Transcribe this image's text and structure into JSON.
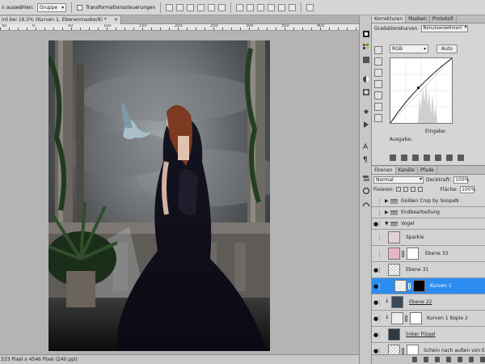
{
  "options_bar": {
    "auto_select_label": "n auswählen:",
    "auto_select_value": "Gruppe",
    "transform_label": "Transformationssteuerungen"
  },
  "document": {
    "tab_title": "ird bei 16,5% (Kurven 1, Ebenenmaske/8) *",
    "close_glyph": "×",
    "ruler_marks": [
      "50",
      "0",
      "50",
      "100",
      "150",
      "200",
      "250",
      "300",
      "350",
      "400"
    ],
    "status": "333 Pixel x 4546 Pixel (240 ppi)"
  },
  "adjustments": {
    "tabs": [
      "Korrekturen",
      "Masken",
      "Protokoll"
    ],
    "title": "Gradationskurven",
    "preset": "Benutzerdefiniert",
    "channel": "RGB",
    "auto_button": "Auto",
    "output_label": "Ausgabe:",
    "input_label": "Eingabe:"
  },
  "layers_panel": {
    "tabs": [
      "Ebenen",
      "Kanäle",
      "Pfade"
    ],
    "blend_mode": "Normal",
    "opacity_label": "Deckkraft:",
    "opacity_value": "100%",
    "lock_label": "Fixieren:",
    "fill_label": "Fläche:",
    "fill_value": "100%",
    "layers": [
      {
        "name": "Golden Crop by SoopeN",
        "kind": "group",
        "visible": false,
        "open": false
      },
      {
        "name": "Endbearbeitung",
        "kind": "group",
        "visible": false,
        "open": false
      },
      {
        "name": "Vogel",
        "kind": "group",
        "visible": true,
        "open": true
      },
      {
        "name": "Sparkle",
        "kind": "layer",
        "visible": false
      },
      {
        "name": "Ebene 33",
        "kind": "layer",
        "visible": false
      },
      {
        "name": "Ebene 31",
        "kind": "layer",
        "visible": true
      },
      {
        "name": "Kurven 1",
        "kind": "adjustment",
        "visible": true,
        "selected": true
      },
      {
        "name": "Ebene 22",
        "kind": "layer",
        "visible": true
      },
      {
        "name": "Kurven 1 Kopie 2",
        "kind": "adjustment",
        "visible": true
      },
      {
        "name": "linker Flügel",
        "kind": "layer",
        "visible": true
      },
      {
        "name": "Schein nach außen von E...",
        "kind": "layer",
        "visible": true
      }
    ]
  },
  "colors": {
    "selection": "#2d8cf0",
    "panel_bg": "#d5d5d5",
    "canvas_bg": "#b4b4b4"
  }
}
